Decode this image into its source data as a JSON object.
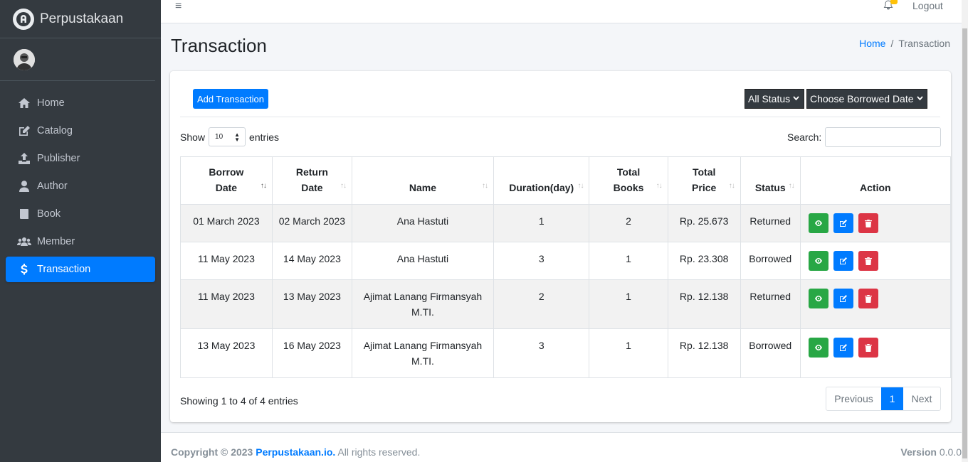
{
  "brand": {
    "name": "Perpustakaan"
  },
  "sidebar": {
    "items": [
      {
        "label": "Home",
        "icon": "home-icon",
        "active": false
      },
      {
        "label": "Catalog",
        "icon": "edit-icon",
        "active": false
      },
      {
        "label": "Publisher",
        "icon": "upload-icon",
        "active": false
      },
      {
        "label": "Author",
        "icon": "user-icon",
        "active": false
      },
      {
        "label": "Book",
        "icon": "book-icon",
        "active": false
      },
      {
        "label": "Member",
        "icon": "users-icon",
        "active": false
      },
      {
        "label": "Transaction",
        "icon": "dollar-icon",
        "active": true
      }
    ]
  },
  "topbar": {
    "menu_icon": "≡",
    "logout_label": "Logout"
  },
  "page": {
    "title": "Transaction"
  },
  "breadcrumb": {
    "home": "Home",
    "separator": "/",
    "current": "Transaction"
  },
  "toolbar": {
    "add_label": "Add Transaction",
    "status_select": "All Status",
    "date_select": "Choose Borrowed Date"
  },
  "datatable": {
    "show_label": "Show",
    "length_value": "10",
    "entries_label": "entries",
    "search_label": "Search:",
    "columns": [
      {
        "label": "Borrow\nDate",
        "lines": [
          "Borrow",
          "Date"
        ]
      },
      {
        "label": "Return\nDate",
        "lines": [
          "Return",
          "Date"
        ]
      },
      {
        "label": "Name",
        "lines": [
          "Name"
        ]
      },
      {
        "label": "Duration(day)",
        "lines": [
          "Duration(day)"
        ]
      },
      {
        "label": "Total\nBooks",
        "lines": [
          "Total",
          "Books"
        ]
      },
      {
        "label": "Total\nPrice",
        "lines": [
          "Total",
          "Price"
        ]
      },
      {
        "label": "Status",
        "lines": [
          "Status"
        ]
      },
      {
        "label": "Action",
        "lines": [
          "Action"
        ]
      }
    ],
    "rows": [
      {
        "borrow": "01 March 2023",
        "return": "02 March 2023",
        "name": "Ana Hastuti",
        "duration": "1",
        "books": "2",
        "price": "Rp. 25.673",
        "status": "Returned"
      },
      {
        "borrow": "11 May 2023",
        "return": "14 May 2023",
        "name": "Ana Hastuti",
        "duration": "3",
        "books": "1",
        "price": "Rp. 23.308",
        "status": "Borrowed"
      },
      {
        "borrow": "11 May 2023",
        "return": "13 May 2023",
        "name": "Ajimat Lanang Firmansyah M.TI.",
        "duration": "2",
        "books": "1",
        "price": "Rp. 12.138",
        "status": "Returned"
      },
      {
        "borrow": "13 May 2023",
        "return": "16 May 2023",
        "name": "Ajimat Lanang Firmansyah M.TI.",
        "duration": "3",
        "books": "1",
        "price": "Rp. 12.138",
        "status": "Borrowed"
      }
    ],
    "info": "Showing 1 to 4 of 4 entries",
    "pagination": {
      "previous": "Previous",
      "current": "1",
      "next": "Next"
    }
  },
  "footer": {
    "copyright_prefix": "Copyright © 2023",
    "brand_link": "Perpustakaan.io.",
    "rights": "All rights reserved.",
    "version_label": "Version",
    "version_value": "0.0.0"
  },
  "colors": {
    "primary": "#007bff",
    "success": "#28a745",
    "danger": "#dc3545",
    "sidebar": "#343a40"
  }
}
